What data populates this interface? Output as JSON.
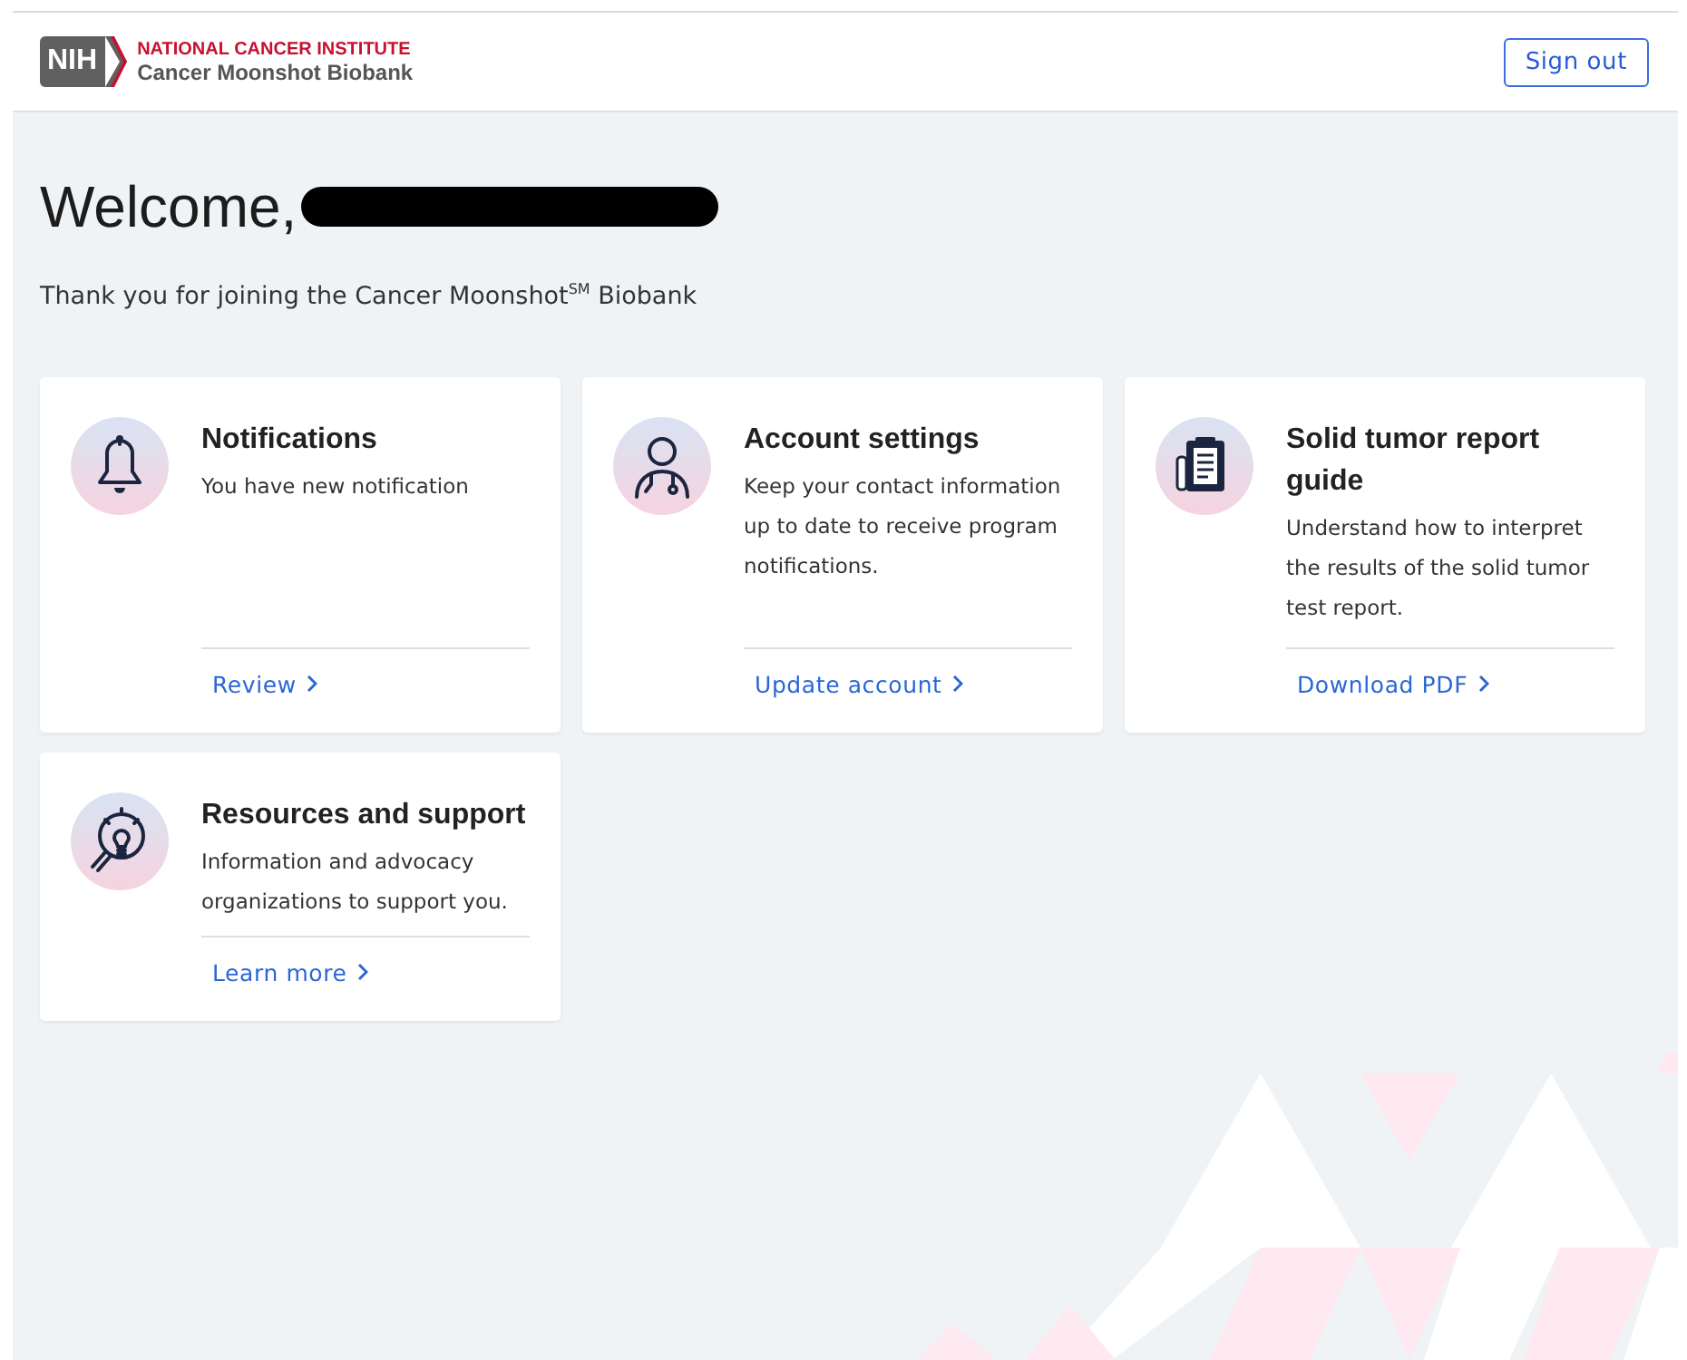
{
  "header": {
    "logo_badge": "NIH",
    "logo_org": "NATIONAL CANCER INSTITUTE",
    "logo_program": "Cancer Moonshot Biobank",
    "sign_out": "Sign out"
  },
  "welcome": {
    "heading": "Welcome,",
    "subtitle": "Thank you for joining the Cancer Moonshot$^{SM}$ Biobank"
  },
  "cards": [
    {
      "kind": "bell",
      "title": "Notifications",
      "text": "You have new notification",
      "link": "Review"
    },
    {
      "kind": "person",
      "title": "Account settings",
      "text": "Keep your contact information up to date to receive program notifications.",
      "link": "Update account"
    },
    {
      "kind": "clipboard",
      "title": "Solid tumor report guide",
      "text": "Understand how to interpret the results of the solid tumor test report.",
      "link": "Download PDF"
    },
    {
      "kind": "lightbulb",
      "title": "Resources and support",
      "text": "Information and advocacy organizations to support you.",
      "link": "Learn more"
    }
  ]
}
